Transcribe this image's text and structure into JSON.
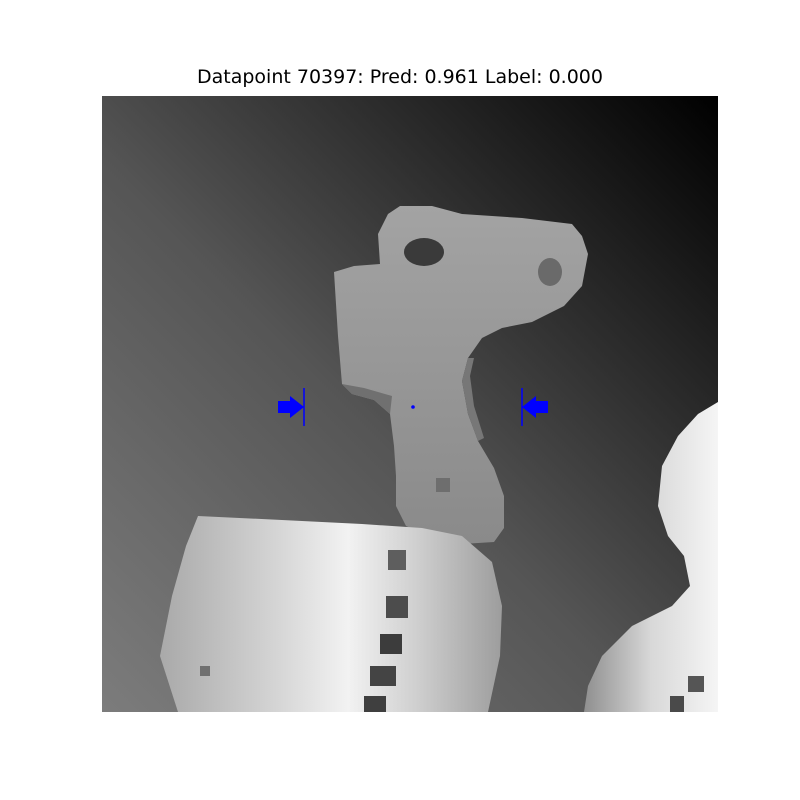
{
  "title": "Datapoint 70397: Pred: 0.961 Label: 0.000",
  "colors": {
    "page_background": "#ffffff",
    "grasp_marker": "#0000ff"
  },
  "image": {
    "description_kind": "grayscale depth image",
    "objects": [
      "background-gradient",
      "gripper-bracket",
      "cylindrical-block",
      "right-rounded-object"
    ]
  }
}
